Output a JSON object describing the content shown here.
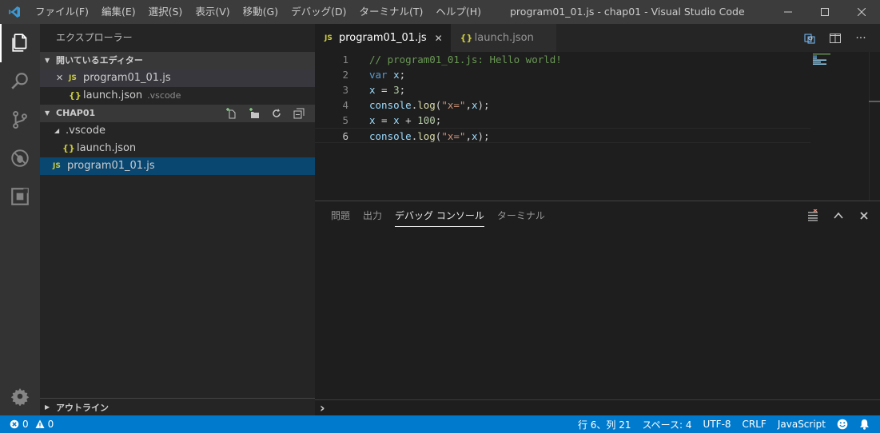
{
  "titlebar": {
    "menu": [
      "ファイル(F)",
      "編集(E)",
      "選択(S)",
      "表示(V)",
      "移動(G)",
      "デバッグ(D)",
      "ターミナル(T)",
      "ヘルプ(H)"
    ],
    "title": "program01_01.js - chap01 - Visual Studio Code"
  },
  "sidebar": {
    "title": "エクスプローラー",
    "open_editors": {
      "header": "開いているエディター",
      "items": [
        {
          "badge": "JS",
          "name": "program01_01.js",
          "desc": ""
        },
        {
          "badge": "{}",
          "name": "launch.json",
          "desc": ".vscode"
        }
      ]
    },
    "workspace": {
      "header": "CHAP01",
      "folder": ".vscode",
      "folder_child": {
        "badge": "{}",
        "name": "launch.json"
      },
      "file": {
        "badge": "JS",
        "name": "program01_01.js"
      }
    },
    "outline_header": "アウトライン"
  },
  "editor": {
    "tabs": [
      {
        "badge": "JS",
        "label": "program01_01.js",
        "active": true
      },
      {
        "badge": "{}",
        "label": "launch.json",
        "active": false
      }
    ],
    "line_numbers": [
      "1",
      "2",
      "3",
      "4",
      "5",
      "6"
    ],
    "code": {
      "l1_comment": "// program01_01.js: Hello world!",
      "l2_kw": "var",
      "l2_var": "x",
      "l2_end": ";",
      "l3_var": "x",
      "l3_op": " = ",
      "l3_num": "3",
      "l3_end": ";",
      "l4_obj": "console",
      "l4_dot": ".",
      "l4_fn": "log",
      "l4_open": "(",
      "l4_str": "\"x=\"",
      "l4_comma": ",",
      "l4_var": "x",
      "l4_close": ");",
      "l5_var1": "x",
      "l5_op1": " = ",
      "l5_var2": "x",
      "l5_op2": " + ",
      "l5_num": "100",
      "l5_end": ";",
      "l6_obj": "console",
      "l6_dot": ".",
      "l6_fn": "log",
      "l6_open": "(",
      "l6_str": "\"x=\"",
      "l6_comma": ",",
      "l6_var": "x",
      "l6_close": ");"
    }
  },
  "panel": {
    "tabs": [
      "問題",
      "出力",
      "デバッグ コンソール",
      "ターミナル"
    ],
    "active_tab": "デバッグ コンソール",
    "prompt": "›"
  },
  "statusbar": {
    "errors": "0",
    "warnings": "0",
    "position": "行 6、列 21",
    "spaces": "スペース: 4",
    "encoding": "UTF-8",
    "eol": "CRLF",
    "language": "JavaScript"
  },
  "colors": {
    "accent": "#007acc",
    "selection": "#094771",
    "js_badge": "#cbcb41"
  }
}
